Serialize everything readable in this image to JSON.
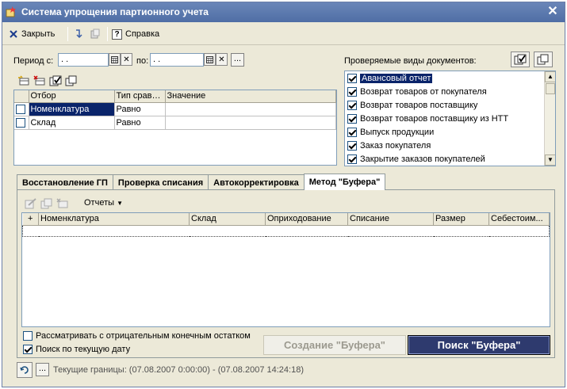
{
  "window": {
    "title": "Система упрощения партионного учета"
  },
  "toolbar": {
    "close_label": "Закрыть",
    "help_label": "Справка"
  },
  "period": {
    "from_label": "Период с:",
    "from_value": " .  .",
    "to_label": "по:",
    "to_value": " .  .",
    "dots": "..."
  },
  "filter_grid": {
    "headers": [
      "Отбор",
      "Тип сравн...",
      "Значение"
    ],
    "rows": [
      {
        "field": "Номенклатура",
        "compare": "Равно",
        "value": "",
        "checked": false
      },
      {
        "field": "Склад",
        "compare": "Равно",
        "value": "",
        "checked": false
      }
    ]
  },
  "doc_types": {
    "label": "Проверяемые виды документов:",
    "items": [
      {
        "label": "Авансовый отчет",
        "checked": true
      },
      {
        "label": "Возврат товаров от покупателя",
        "checked": true
      },
      {
        "label": "Возврат товаров поставщику",
        "checked": true
      },
      {
        "label": "Возврат товаров поставщику из НТТ",
        "checked": true
      },
      {
        "label": "Выпуск продукции",
        "checked": true
      },
      {
        "label": "Заказ покупателя",
        "checked": true
      },
      {
        "label": "Закрытие заказов покупателей",
        "checked": true
      }
    ]
  },
  "tabs": [
    {
      "label": "Восстановление ГП",
      "active": false
    },
    {
      "label": "Проверка списания",
      "active": false
    },
    {
      "label": "Автокорректировка",
      "active": false
    },
    {
      "label": "Метод \"Буфера\"",
      "active": true
    }
  ],
  "buffer": {
    "reports_label": "Отчеты",
    "columns": [
      "+",
      "Номенклатура",
      "Склад",
      "Оприходование",
      "Списание",
      "Размер",
      "Себестоим..."
    ],
    "negative_label": "Рассматривать с отрицательным конечным остатком",
    "negative_checked": false,
    "current_date_label": "Поиск по текущую дату",
    "current_date_checked": true,
    "create_button": "Создание \"Буфера\"",
    "search_button": "Поиск \"Буфера\""
  },
  "status": {
    "dots": "...",
    "text": "Текущие границы: (07.08.2007 0:00:00) - (07.08.2007 14:24:18)"
  },
  "colors": {
    "title_bar": "#5a78ae",
    "selection": "#0a246a",
    "search_button": "#2e3a6e"
  }
}
